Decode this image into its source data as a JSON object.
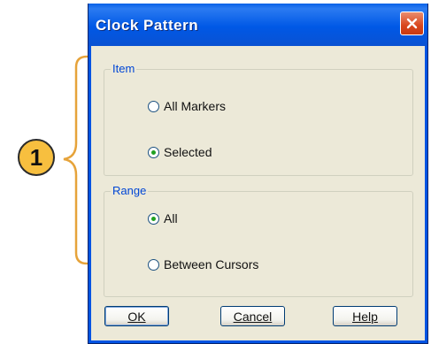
{
  "callout": {
    "number": "1"
  },
  "window": {
    "title": "Clock Pattern",
    "close_icon": "close-icon"
  },
  "item_group": {
    "legend": "Item",
    "options": [
      {
        "label": "All Markers",
        "selected": false
      },
      {
        "label": "Selected",
        "selected": true
      }
    ]
  },
  "range_group": {
    "legend": "Range",
    "options": [
      {
        "label": "All",
        "selected": true
      },
      {
        "label": "Between Cursors",
        "selected": false
      }
    ]
  },
  "buttons": {
    "ok": "OK",
    "cancel": "Cancel",
    "help": "Help"
  },
  "colors": {
    "titlebar": "#0058e6",
    "client": "#ece9d8",
    "legend_text": "#0046d5",
    "callout": "#f7bf3f",
    "brace": "#e6a33a",
    "close_button": "#d9461d",
    "radio_dot": "#21a121"
  }
}
